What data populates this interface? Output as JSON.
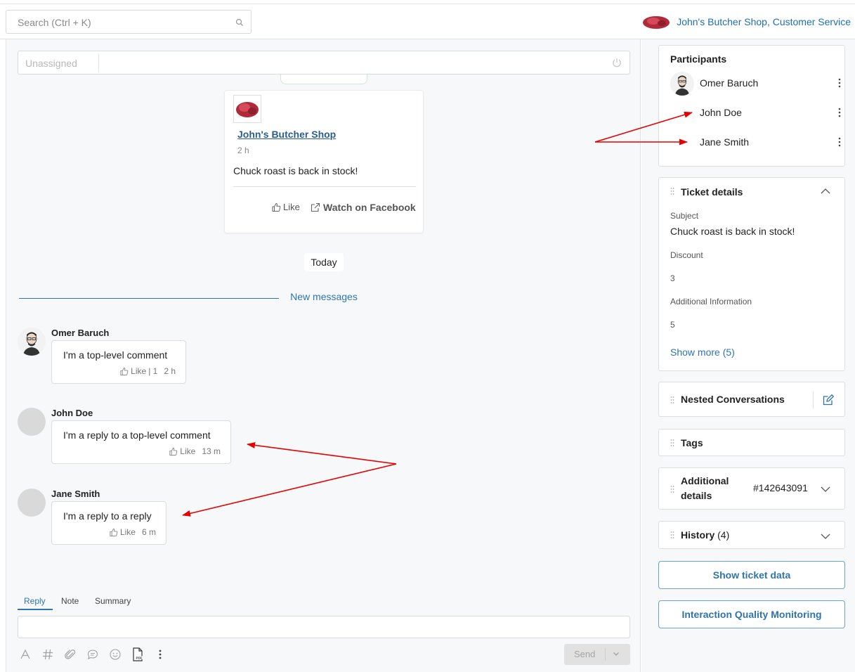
{
  "header": {
    "search_placeholder": "Search (Ctrl + K)",
    "brand": "John's Butcher Shop, Customer Service"
  },
  "assign": {
    "placeholder": "Unassigned"
  },
  "post": {
    "author": "John's Butcher Shop",
    "time": "2 h",
    "text": "Chuck roast is back in stock!",
    "like": "Like",
    "watch": "Watch on Facebook"
  },
  "date_label": "Today",
  "new_messages": "New messages",
  "comments": [
    {
      "author": "Omer Baruch",
      "text": "I'm a top-level comment",
      "like": "Like",
      "like_count": "| 1",
      "time": "2 h"
    },
    {
      "author": "John Doe",
      "text": "I'm a reply to a top-level comment",
      "like": "Like",
      "time": "13 m"
    },
    {
      "author": "Jane Smith",
      "text": "I'm a reply to a reply",
      "like": "Like",
      "time": "6 m"
    }
  ],
  "composer": {
    "tabs": [
      "Reply",
      "Note",
      "Summary"
    ],
    "active_tab": "Reply",
    "send": "Send"
  },
  "sidebar": {
    "participants": {
      "title": "Participants",
      "people": [
        "Omer Baruch",
        "John Doe",
        "Jane Smith"
      ]
    },
    "ticket_details": {
      "title": "Ticket details",
      "subject_label": "Subject",
      "subject": "Chuck roast is back in stock!",
      "discount_label": "Discount",
      "discount": "3",
      "info_label": "Additional Information",
      "info": "5",
      "show_more": "Show more (5)"
    },
    "nested_title": "Nested Conversations",
    "tags_title": "Tags",
    "additional": {
      "title_line1": "Additional",
      "title_line2": "details",
      "ticket_id": "#142643091"
    },
    "history": {
      "title": "History",
      "count": "(4)"
    },
    "show_ticket_data": "Show ticket data",
    "iqm": "Interaction Quality Monitoring"
  },
  "colors": {
    "accent": "#2f74ad",
    "arrow": "#e60000"
  }
}
